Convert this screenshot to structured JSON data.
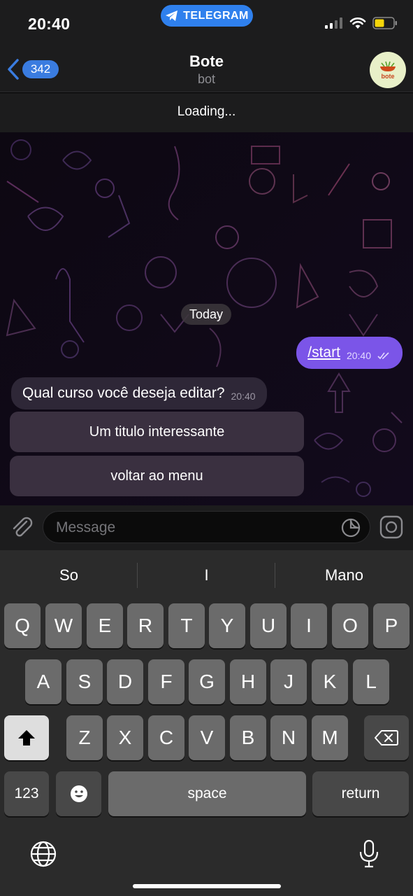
{
  "status_bar": {
    "time": "20:40",
    "app_pill": "TELEGRAM",
    "icons": [
      "signal-icon",
      "wifi-icon",
      "battery-icon"
    ],
    "battery_color": "#f5d60a"
  },
  "header": {
    "back_count": "342",
    "title": "Bote",
    "subtitle": "bot",
    "avatar_text": "bote"
  },
  "loading_text": "Loading...",
  "chat": {
    "date_label": "Today",
    "messages": [
      {
        "direction": "outgoing",
        "text": "/start",
        "time": "20:40",
        "read": true
      },
      {
        "direction": "incoming",
        "text": "Qual curso você deseja editar?",
        "time": "20:40"
      }
    ],
    "inline_buttons": [
      "Um titulo interessante",
      "voltar ao menu"
    ]
  },
  "input": {
    "placeholder": "Message",
    "value": ""
  },
  "keyboard": {
    "suggestions": [
      "So",
      "I",
      "Mano"
    ],
    "row1": [
      "Q",
      "W",
      "E",
      "R",
      "T",
      "Y",
      "U",
      "I",
      "O",
      "P"
    ],
    "row2": [
      "A",
      "S",
      "D",
      "F",
      "G",
      "H",
      "J",
      "K",
      "L"
    ],
    "row3": [
      "Z",
      "X",
      "C",
      "V",
      "B",
      "N",
      "M"
    ],
    "numbers_label": "123",
    "space_label": "space",
    "return_label": "return"
  },
  "colors": {
    "accent": "#2f80ed",
    "outgoing_bubble": "#7b55e8",
    "incoming_bubble": "#2e2737",
    "chat_background": "#0b0712"
  }
}
